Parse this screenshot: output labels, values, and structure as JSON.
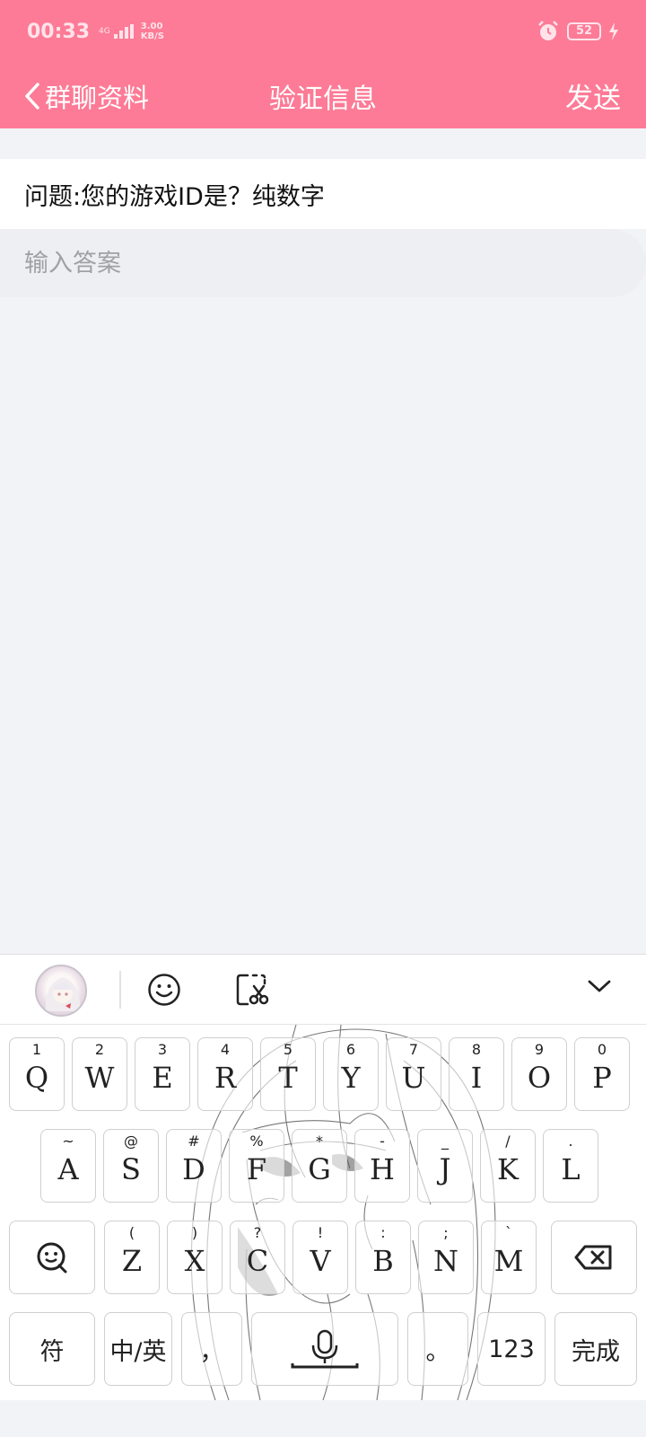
{
  "status_bar": {
    "time": "00:33",
    "net_type": "4G",
    "speed_value": "3.00",
    "speed_unit": "KB/S",
    "battery": "52"
  },
  "nav": {
    "back_label": "群聊资料",
    "title": "验证信息",
    "send_label": "发送"
  },
  "question": "问题:您的游戏ID是？纯数字",
  "answer": {
    "placeholder": "输入答案",
    "value": ""
  },
  "keyboard": {
    "row1": [
      {
        "hint": "1",
        "key": "Q"
      },
      {
        "hint": "2",
        "key": "W"
      },
      {
        "hint": "3",
        "key": "E"
      },
      {
        "hint": "4",
        "key": "R"
      },
      {
        "hint": "5",
        "key": "T"
      },
      {
        "hint": "6",
        "key": "Y"
      },
      {
        "hint": "7",
        "key": "U"
      },
      {
        "hint": "8",
        "key": "I"
      },
      {
        "hint": "9",
        "key": "O"
      },
      {
        "hint": "0",
        "key": "P"
      }
    ],
    "row2": [
      {
        "hint": "~",
        "key": "A"
      },
      {
        "hint": "@",
        "key": "S"
      },
      {
        "hint": "#",
        "key": "D"
      },
      {
        "hint": "%",
        "key": "F"
      },
      {
        "hint": "*",
        "key": "G"
      },
      {
        "hint": "-",
        "key": "H"
      },
      {
        "hint": "_",
        "key": "J"
      },
      {
        "hint": "/",
        "key": "K"
      },
      {
        "hint": ".",
        "key": "L"
      }
    ],
    "row3": [
      {
        "hint": "(",
        "key": "Z"
      },
      {
        "hint": ")",
        "key": "X"
      },
      {
        "hint": "?",
        "key": "C"
      },
      {
        "hint": "!",
        "key": "V"
      },
      {
        "hint": ":",
        "key": "B"
      },
      {
        "hint": ";",
        "key": "N"
      },
      {
        "hint": "`",
        "key": "M"
      }
    ],
    "symbol_label": "符",
    "lang_label": "中/英",
    "comma_label": "，",
    "period_label": "。",
    "num_label": "123",
    "done_label": "完成"
  },
  "colors": {
    "header": "#fd7b96",
    "background": "#f2f3f7"
  }
}
